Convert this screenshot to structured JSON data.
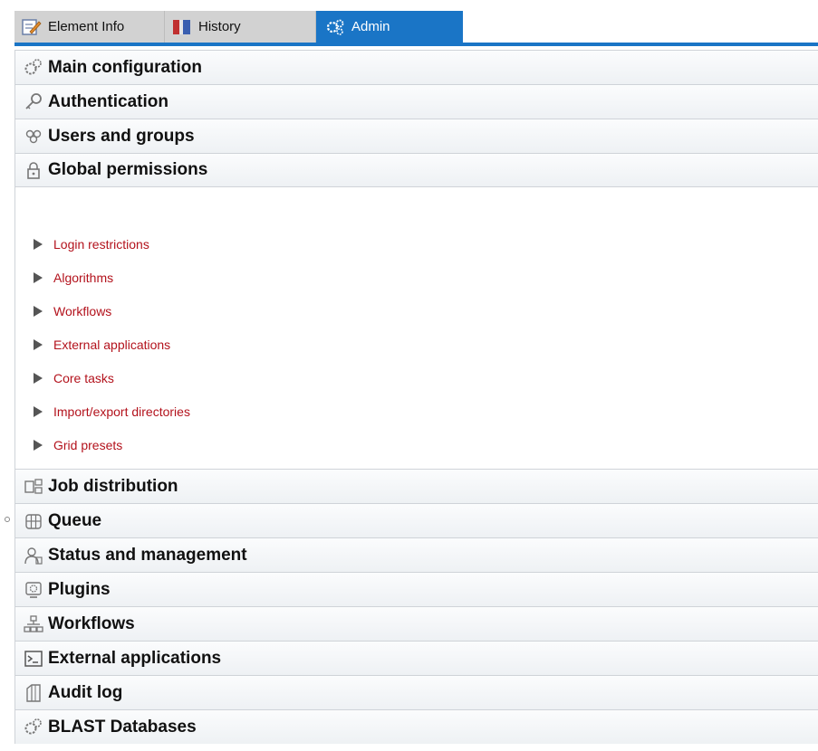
{
  "tabs": [
    {
      "label": "Element Info",
      "icon": "element-info-icon",
      "active": false
    },
    {
      "label": "History",
      "icon": "history-icon",
      "active": false
    },
    {
      "label": "Admin",
      "icon": "admin-icon",
      "active": true
    }
  ],
  "sections": [
    {
      "label": "Main configuration",
      "icon": "gears-icon"
    },
    {
      "label": "Authentication",
      "icon": "key-icon"
    },
    {
      "label": "Users and groups",
      "icon": "users-icon"
    },
    {
      "label": "Global permissions",
      "icon": "lock-icon",
      "expanded": true
    },
    {
      "label": "Job distribution",
      "icon": "job-distribution-icon"
    },
    {
      "label": "Queue",
      "icon": "queue-icon"
    },
    {
      "label": "Status and management",
      "icon": "status-icon"
    },
    {
      "label": "Plugins",
      "icon": "plugins-icon"
    },
    {
      "label": "Workflows",
      "icon": "workflows-icon"
    },
    {
      "label": "External applications",
      "icon": "terminal-icon"
    },
    {
      "label": "Audit log",
      "icon": "audit-log-icon"
    },
    {
      "label": "BLAST Databases",
      "icon": "gears-icon"
    }
  ],
  "global_permissions_items": [
    {
      "label": "Login restrictions"
    },
    {
      "label": "Algorithms"
    },
    {
      "label": "Workflows"
    },
    {
      "label": "External applications"
    },
    {
      "label": "Core tasks"
    },
    {
      "label": "Import/export directories"
    },
    {
      "label": "Grid presets"
    }
  ],
  "colors": {
    "accent": "#1a75c6",
    "link": "#b3121c",
    "tab_inactive": "#d2d2d2"
  }
}
